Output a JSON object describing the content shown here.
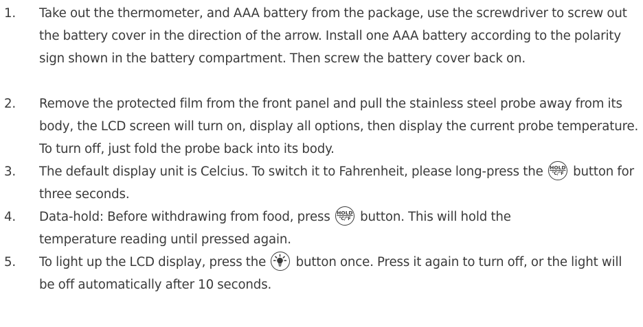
{
  "instructions": [
    {
      "number": "1.",
      "text": "Take out the thermometer, and AAA battery from the package, use the screwdriver to screw out the battery cover in the direction of the arrow. Install one AAA battery according to the polarity sign shown in the battery compartment. Then screw the battery cover back on."
    },
    {
      "number": "2.",
      "text": "Remove the protected film from the front panel and pull the stainless steel probe away from its body, the LCD screen will turn on, display all options, then display the current probe temperature. To turn off, just fold the probe back into its body."
    },
    {
      "number": "3.",
      "text_before": "The default display unit is Celcius. To switch it to Fahrenheit, please long-press the",
      "text_after": "button for three seconds."
    },
    {
      "number": "4.",
      "text_before": "Data-hold: Before withdrawing from food, press",
      "text_after": "button. This will hold the temperature reading until pressed again."
    },
    {
      "number": "5.",
      "text_before": "To light up the LCD display, press the",
      "text_after": "button once. Press it again to turn off, or the light will be off automatically after 10 seconds."
    }
  ],
  "hold_button": {
    "label_top": "HOLD",
    "label_bottom": "°C/°F",
    "icon": "hold-unit-button-icon"
  },
  "light_button": {
    "icon": "backlight-bulb-button-icon"
  },
  "colors": {
    "text": "#3a3a3a",
    "background": "#ffffff"
  }
}
